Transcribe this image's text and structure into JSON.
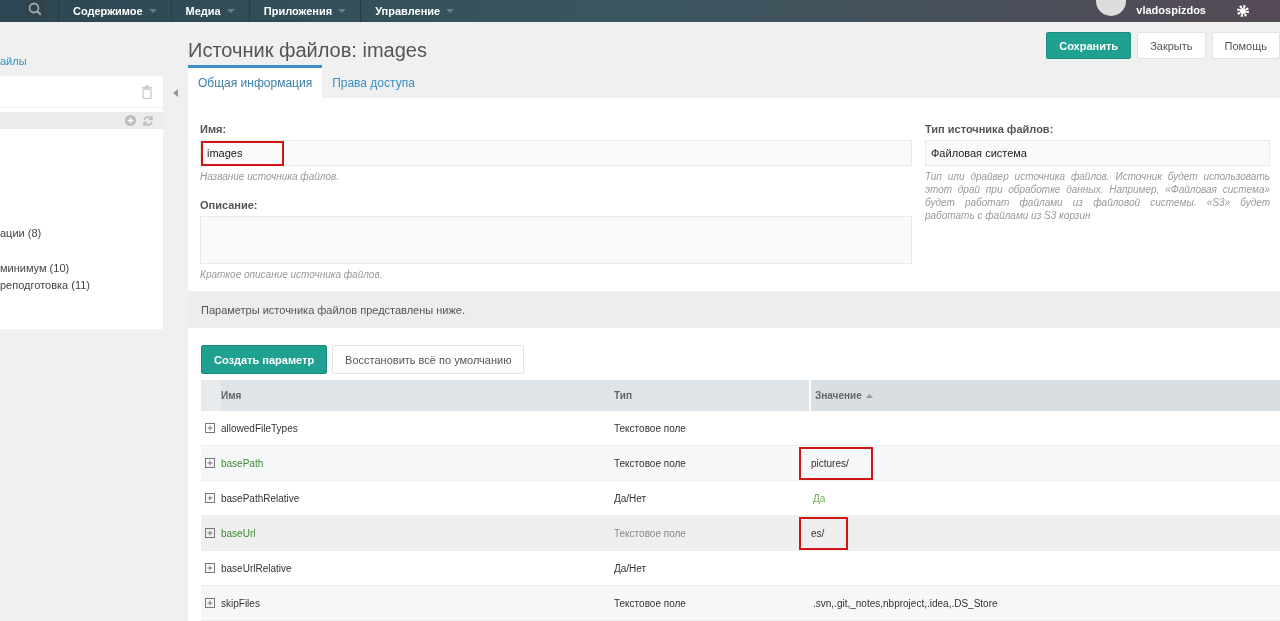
{
  "topbar": {
    "menu": [
      {
        "label": "Содержимое"
      },
      {
        "label": "Медиа"
      },
      {
        "label": "Приложения"
      },
      {
        "label": "Управление"
      }
    ],
    "username": "vladospizdos"
  },
  "sidebar": {
    "link": "айлы",
    "items": [
      "ации (8)",
      "минимум (10)",
      "реподготовка (11)"
    ]
  },
  "page": {
    "title": "Источник файлов: images",
    "buttons": [
      {
        "label": "Сохранить",
        "kind": "primary"
      },
      {
        "label": "Закрыть",
        "kind": "default"
      },
      {
        "label": "Помощь",
        "kind": "default"
      }
    ]
  },
  "tabs": [
    {
      "label": "Общая информация",
      "selected": true
    },
    {
      "label": "Права доступа",
      "selected": false
    }
  ],
  "form": {
    "name": {
      "label": "Имя:",
      "value": "images",
      "hint": "Название источника файлов.",
      "highlighted": true
    },
    "description": {
      "label": "Описание:",
      "hint": "Краткое описание источника файлов."
    },
    "type": {
      "label": "Тип источника файлов:",
      "value": "Файловая система",
      "hint": "Тип или драйвер источника файлов. Источник будет использовать этот драй при обработке данных. Например, «Файловая система» будет работат файлами из файловой системы. «S3» будет работать с файлами из S3 корзин"
    }
  },
  "params_note": "Параметры источника файлов представлены ниже.",
  "param_buttons": [
    {
      "label": "Создать параметр",
      "kind": "primary"
    },
    {
      "label": "Восстановить всё по умолчанию",
      "kind": "default"
    }
  ],
  "table": {
    "columns": [
      "Имя",
      "Тип",
      "Значение"
    ],
    "rows": [
      {
        "name": "allowedFileTypes",
        "type": "Текстовое поле",
        "modified": false,
        "hovered": false
      },
      {
        "name": "basePath",
        "type": "Текстовое поле",
        "value": "pictures/",
        "kind": "text",
        "modified": true,
        "hovered": false,
        "highlighted": true
      },
      {
        "name": "basePathRelative",
        "type": "Да/Нет",
        "value": "Да",
        "kind": "bool",
        "modified": false,
        "hovered": false,
        "highlighted": false
      },
      {
        "name": "baseUrl",
        "type": "Текстовое поле",
        "value": "es/",
        "kind": "text",
        "modified": true,
        "hovered": true,
        "highlighted": true
      },
      {
        "name": "baseUrlRelative",
        "type": "Да/Нет",
        "modified": false,
        "hovered": false
      },
      {
        "name": "skipFiles",
        "type": "Текстовое поле",
        "value": ".svn,.git,_notes,nbproject,.idea,.DS_Store",
        "kind": "text",
        "modified": false,
        "hovered": false,
        "highlighted": false
      }
    ]
  }
}
